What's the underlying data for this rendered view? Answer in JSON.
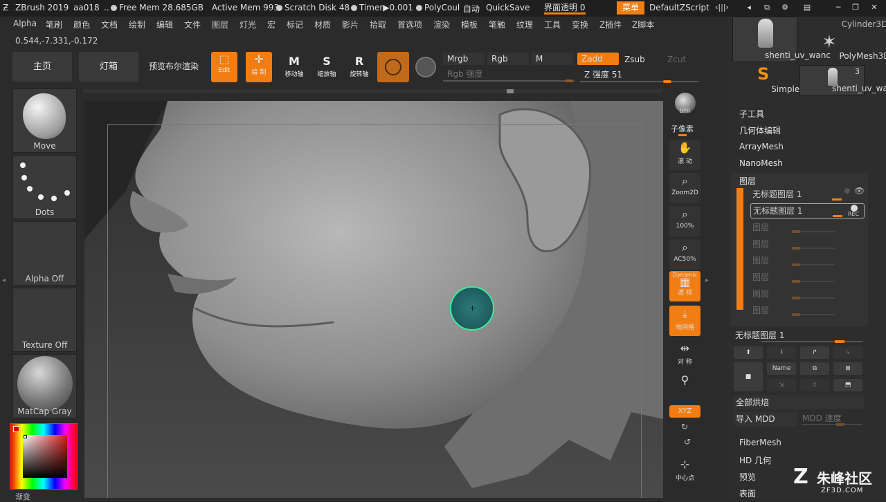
{
  "titlebar": {
    "app": "ZBrush 2019",
    "doc": "aa018",
    "ellipsis": "..",
    "free_mem": "Free Mem 28.685GB",
    "active_mem": "Active Mem 993",
    "scratch_disk": "Scratch Disk 48",
    "timer": "Timer▶0.001",
    "polycount": "PolyCoul",
    "auto": "自动",
    "quicksave": "QuickSave",
    "ui_transparency": "界面透明 0",
    "menu_button": "菜单",
    "default_zscript": "DefaultZScript"
  },
  "menubar": [
    "Alpha",
    "笔刷",
    "颜色",
    "文档",
    "绘制",
    "编辑",
    "文件",
    "图层",
    "灯光",
    "宏",
    "标记",
    "材质",
    "影片",
    "拾取",
    "首选项",
    "渲染",
    "模板",
    "笔触",
    "纹理",
    "工具",
    "变换",
    "Z插件",
    "Z脚本"
  ],
  "coords": "0.544,-7.331,-0.172",
  "toolbar": {
    "home": "主页",
    "lightbox": "灯箱",
    "bpr_preview": "预览布尔渲染",
    "edit": "Edit",
    "draw": "绘 制",
    "move": "移动轴",
    "scale": "缩放轴",
    "rotate": "旋转轴",
    "mrgb": "Mrgb",
    "rgb": "Rgb",
    "m": "M",
    "zadd": "Zadd",
    "zsub": "Zsub",
    "zcut": "Zcut",
    "rgb_intensity": "Rgb 强度",
    "z_intensity": "Z 强度 51",
    "z_intensity_value": 51
  },
  "left_shelf": {
    "brush": "Move",
    "stroke": "Dots",
    "alpha": "Alpha Off",
    "texture": "Texture Off",
    "material": "MatCap Gray",
    "color_label": "渐变"
  },
  "right_shelf": {
    "bpr": "BPR",
    "subpixel": "子像素",
    "scroll": "滚 动",
    "zoom2d": "Zoom2D",
    "zoom100": "100%",
    "ac50": "AC50%",
    "dynamic": "Dynamic",
    "perspective": "透 视",
    "floor": "地网格",
    "frame": "对 称",
    "xyz": "XYZ",
    "center": "中心点"
  },
  "tool_panel": {
    "thumbs": [
      {
        "label": "shenti_uv_wanc",
        "count": ""
      },
      {
        "label": "Cylinder3D",
        "count": ""
      },
      {
        "label": "SimpleBrush",
        "count": ""
      },
      {
        "label": "PolyMesh3D",
        "count": ""
      },
      {
        "label": "shenti_uv_wanc",
        "count": "3"
      }
    ],
    "subtool": "子工具",
    "geometry": "几何体编辑",
    "arraymesh": "ArrayMesh",
    "nanomesh": "NanoMesh",
    "layers": "图层",
    "layer_items": [
      {
        "name": "无标题图层 1",
        "dim": false
      },
      {
        "name": "无标题图层 1",
        "dim": false,
        "rec": "REC"
      },
      {
        "name": "图层",
        "dim": true
      },
      {
        "name": "图层",
        "dim": true
      },
      {
        "name": "图层",
        "dim": true
      },
      {
        "name": "图层",
        "dim": true
      },
      {
        "name": "图层",
        "dim": true
      },
      {
        "name": "图层",
        "dim": true
      }
    ],
    "current_layer": "无标题图层 1",
    "name_btn": "Name",
    "bake_all": "全部烘焙",
    "import_mdd": "导入 MDD",
    "mdd_speed": "MDD 速度",
    "fibermesh": "FiberMesh",
    "hd_geometry": "HD 几何",
    "preview": "预览",
    "surface": "表面"
  },
  "watermark": {
    "text": "朱峰社区",
    "url": "ZF3D.COM"
  }
}
